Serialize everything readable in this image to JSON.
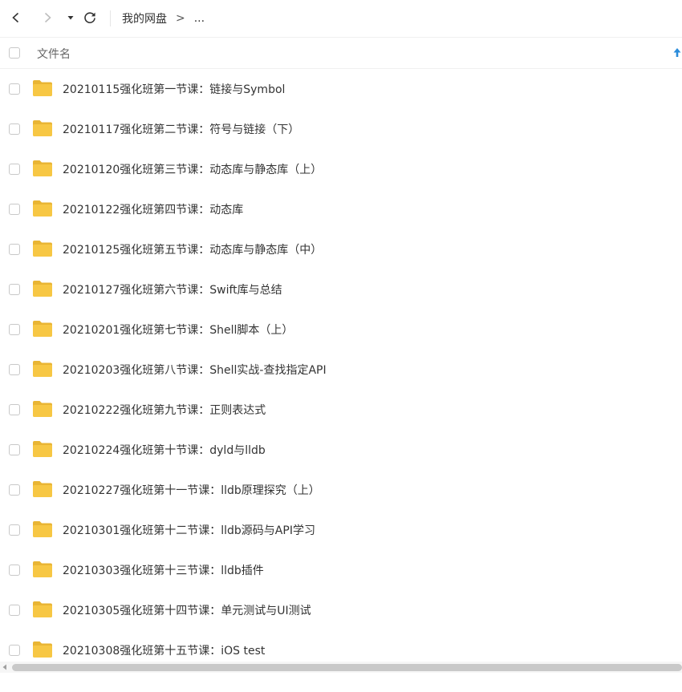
{
  "toolbar": {
    "back_icon": "chevron-left-icon",
    "forward_icon": "chevron-right-icon",
    "history_dropdown_icon": "caret-down-icon",
    "refresh_icon": "refresh-icon"
  },
  "breadcrumb": {
    "root": "我的网盘",
    "separator": ">",
    "ellipsis": "..."
  },
  "header": {
    "name_column": "文件名",
    "sort_icon": "arrow-up-icon",
    "sort_color": "#2b8cdb"
  },
  "folder_color": "#f7c744",
  "files": [
    {
      "name": "20210115强化班第一节课：链接与Symbol"
    },
    {
      "name": "20210117强化班第二节课：符号与链接（下）"
    },
    {
      "name": "20210120强化班第三节课：动态库与静态库（上）"
    },
    {
      "name": "20210122强化班第四节课：动态库"
    },
    {
      "name": "20210125强化班第五节课：动态库与静态库（中）"
    },
    {
      "name": "20210127强化班第六节课：Swift库与总结"
    },
    {
      "name": "20210201强化班第七节课：Shell脚本（上）"
    },
    {
      "name": "20210203强化班第八节课：Shell实战-查找指定API"
    },
    {
      "name": "20210222强化班第九节课：正则表达式"
    },
    {
      "name": "20210224强化班第十节课：dyld与lldb"
    },
    {
      "name": "20210227强化班第十一节课：lldb原理探究（上）"
    },
    {
      "name": "20210301强化班第十二节课：lldb源码与API学习"
    },
    {
      "name": "20210303强化班第十三节课：lldb插件"
    },
    {
      "name": "20210305强化班第十四节课：单元测试与UI测试"
    },
    {
      "name": "20210308强化班第十五节课：iOS test"
    }
  ]
}
